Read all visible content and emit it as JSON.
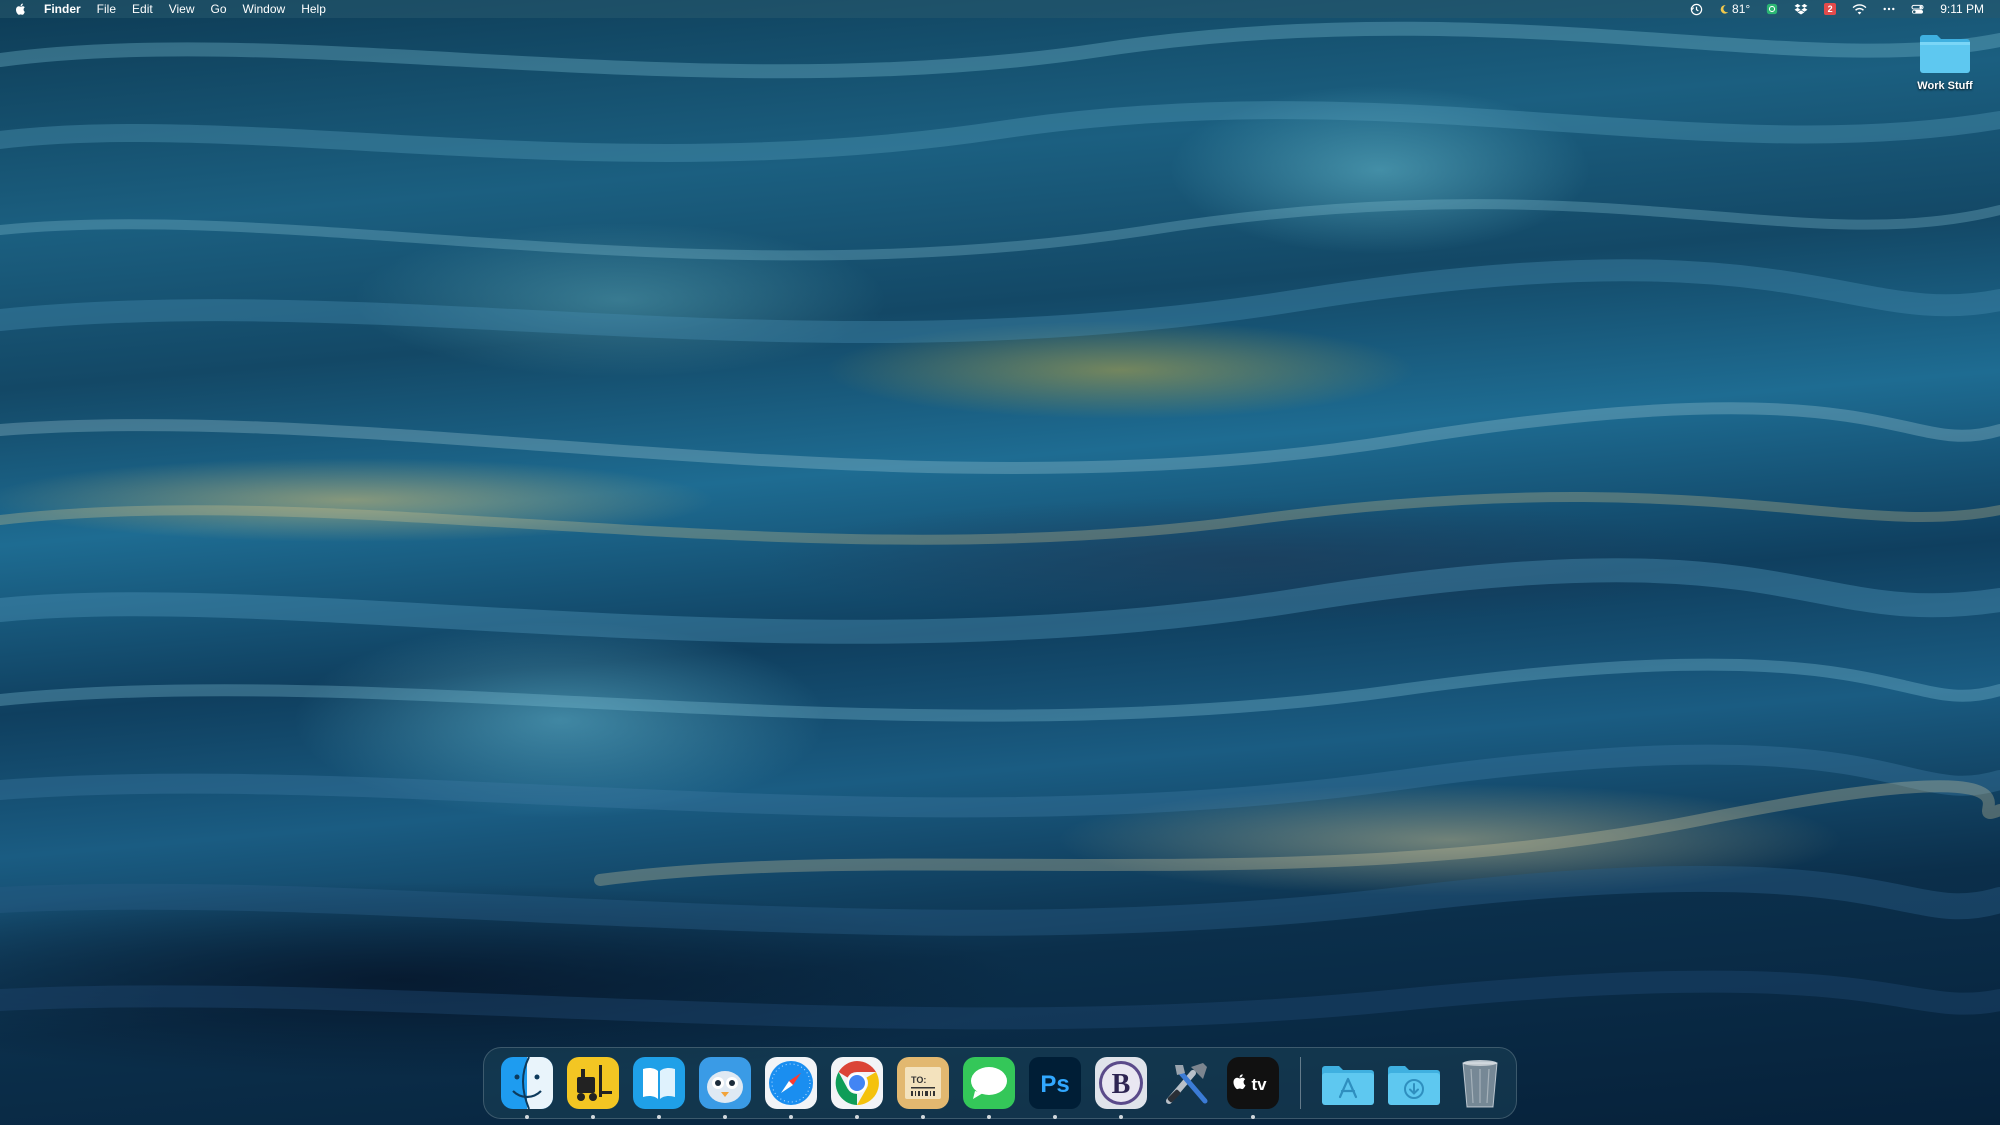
{
  "menubar": {
    "app_name": "Finder",
    "menus": [
      "File",
      "Edit",
      "View",
      "Go",
      "Window",
      "Help"
    ],
    "status": {
      "temperature": "81°",
      "calendar_badge": "2",
      "time": "9:11 PM"
    }
  },
  "desktop": {
    "folder_label": "Work Stuff"
  },
  "dock": {
    "apps": [
      {
        "id": "finder",
        "icon": "finder-icon",
        "running": true
      },
      {
        "id": "forklift",
        "icon": "forklift-icon",
        "running": true
      },
      {
        "id": "reader",
        "icon": "book-reader-icon",
        "running": true
      },
      {
        "id": "tweetbot",
        "icon": "tweetbot-icon",
        "running": true
      },
      {
        "id": "safari",
        "icon": "safari-compass-icon",
        "running": true
      },
      {
        "id": "chrome",
        "icon": "chrome-icon",
        "running": true
      },
      {
        "id": "deliveries",
        "icon": "package-icon",
        "running": true,
        "label": "TO:"
      },
      {
        "id": "messages",
        "icon": "messages-icon",
        "running": true
      },
      {
        "id": "photoshop",
        "icon": "photoshop-icon",
        "running": true,
        "label": "Ps"
      },
      {
        "id": "bbedit",
        "icon": "bbedit-icon",
        "running": true,
        "label": "B"
      },
      {
        "id": "xcode-tools",
        "icon": "tools-icon",
        "running": false
      },
      {
        "id": "apple-tv",
        "icon": "apple-tv-icon",
        "running": true,
        "label": "tv"
      }
    ],
    "stacks": [
      {
        "id": "applications",
        "icon": "applications-folder-icon"
      },
      {
        "id": "downloads",
        "icon": "downloads-folder-icon"
      },
      {
        "id": "trash",
        "icon": "trash-icon"
      }
    ]
  },
  "colors": {
    "menubar_bg": "#285a6e",
    "folder_blue": "#5ec8f0",
    "chrome_red": "#db4437",
    "chrome_yellow": "#f4c20d",
    "chrome_green": "#0f9d58",
    "chrome_blue": "#4285f4",
    "photoshop_bg": "#001e36",
    "photoshop_text": "#31a8ff",
    "messages_green": "#34c759"
  }
}
